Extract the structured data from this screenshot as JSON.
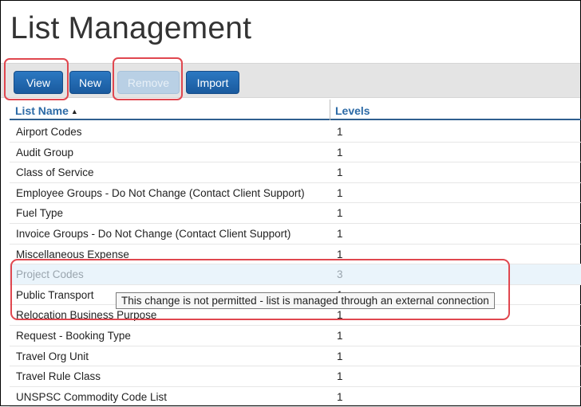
{
  "page_title": "List Management",
  "toolbar": {
    "view_label": "View",
    "new_label": "New",
    "remove_label": "Remove",
    "import_label": "Import"
  },
  "table": {
    "columns": {
      "name": "List Name",
      "levels": "Levels"
    },
    "sort_indicator": "▲",
    "rows": [
      {
        "name": "Airport Codes",
        "levels": "1"
      },
      {
        "name": "Audit Group",
        "levels": "1"
      },
      {
        "name": "Class of Service",
        "levels": "1"
      },
      {
        "name": "Employee Groups - Do Not Change (Contact Client Support)",
        "levels": "1"
      },
      {
        "name": "Fuel Type",
        "levels": "1"
      },
      {
        "name": "Invoice Groups - Do Not Change (Contact Client Support)",
        "levels": "1"
      },
      {
        "name": "Miscellaneous Expense",
        "levels": "1"
      },
      {
        "name": "Project Codes",
        "levels": "3"
      },
      {
        "name": "Public Transport",
        "levels": "1"
      },
      {
        "name": "Relocation Business Purpose",
        "levels": "1"
      },
      {
        "name": "Request - Booking Type",
        "levels": "1"
      },
      {
        "name": "Travel Org Unit",
        "levels": "1"
      },
      {
        "name": "Travel Rule Class",
        "levels": "1"
      },
      {
        "name": "UNSPSC Commodity Code List",
        "levels": "1"
      }
    ]
  },
  "tooltip": "This change is not permitted - list is managed through an external connection",
  "colors": {
    "button_primary": "#1f63aa",
    "button_disabled": "#b9d0e5",
    "highlight_outline": "#e0474f",
    "header_text": "#2c6aa6",
    "selected_row_bg": "#eaf4fb"
  }
}
